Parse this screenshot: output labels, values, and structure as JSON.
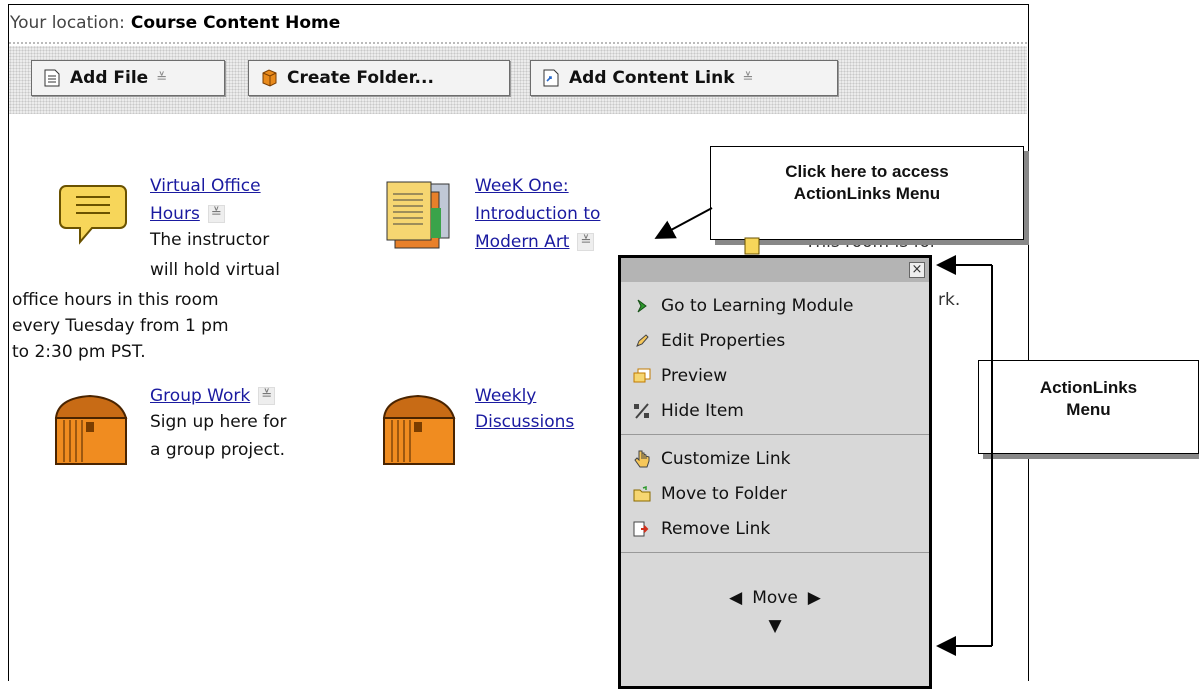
{
  "location": {
    "prefix": "Your location:",
    "current": "Course Content Home"
  },
  "toolbar": {
    "add_file": "Add File",
    "create_folder": "Create Folder...",
    "add_content_link": "Add Content Link"
  },
  "items": {
    "office_hours": {
      "title_line1": "Virtual Office",
      "title_line2": "Hours",
      "desc": [
        "The instructor",
        "will hold virtual",
        "office hours in this room",
        "every Tuesday from 1 pm",
        "to 2:30 pm PST."
      ]
    },
    "week_one": {
      "title_line1": "WeeK One:",
      "title_line2": "Introduction to",
      "title_line3": "Modern Art"
    },
    "group_work": {
      "title": "Group Work",
      "desc": [
        "Sign up here for",
        "a group project."
      ]
    },
    "weekly": {
      "title_line1": "Weekly",
      "title_line2": "Discussions"
    },
    "hidden_partial": {
      "line1": "This room is for",
      "line2": "rk."
    }
  },
  "callouts": {
    "access": {
      "line1": "Click here to access",
      "line2": "ActionLinks Menu"
    },
    "menu": {
      "line1": "ActionLinks",
      "line2": "Menu"
    }
  },
  "actionlinks": {
    "close": "×",
    "items": [
      {
        "label": "Go to Learning Module",
        "icon": "go-arrow-icon"
      },
      {
        "label": "Edit Properties",
        "icon": "pencil-icon"
      },
      {
        "label": "Preview",
        "icon": "preview-window-icon"
      },
      {
        "label": "Hide Item",
        "icon": "hide-item-icon"
      },
      {
        "label": "Customize Link",
        "icon": "hand-cursor-icon"
      },
      {
        "label": "Move to Folder",
        "icon": "folder-move-icon"
      },
      {
        "label": "Remove Link",
        "icon": "remove-link-icon"
      }
    ],
    "move": "Move"
  },
  "colors": {
    "link": "#1a1aa0",
    "menu_bg": "#d8d8d8",
    "menu_head": "#b4b4b4"
  }
}
